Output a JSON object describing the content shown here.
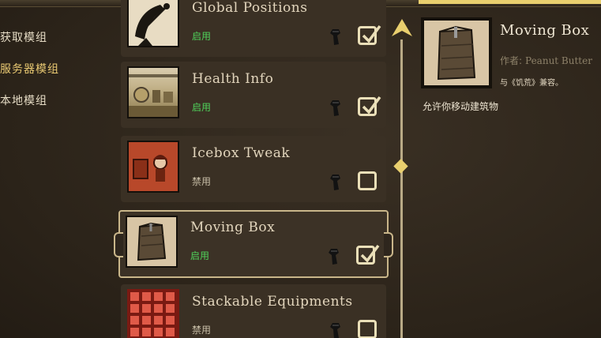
{
  "nav": {
    "items": [
      {
        "label": "获取模组",
        "active": false
      },
      {
        "label": "服务器模组",
        "active": true
      },
      {
        "label": "本地模组",
        "active": false
      }
    ]
  },
  "mods": [
    {
      "name": "Global Positions",
      "status": "启用",
      "enabled": true,
      "icon": "satellite-dish-icon"
    },
    {
      "name": "Health Info",
      "status": "启用",
      "enabled": true,
      "icon": "health-info-thumbnail"
    },
    {
      "name": "Icebox Tweak",
      "status": "禁用",
      "enabled": false,
      "icon": "icebox-tweak-thumbnail"
    },
    {
      "name": "Moving Box",
      "status": "启用",
      "enabled": true,
      "selected": true,
      "icon": "moving-box-thumbnail"
    },
    {
      "name": "Stackable Equipments",
      "status": "禁用",
      "enabled": false,
      "icon": "stackable-equipments-thumbnail"
    }
  ],
  "detail": {
    "title": "Moving Box",
    "author_label": "作者:",
    "author": "Peanut Butter",
    "compat": "与《饥荒》兼容。",
    "description": "允许你移动建筑物"
  },
  "colors": {
    "enabled": "#4fd15a",
    "disabled": "#c9bfa8",
    "accent": "#e9cf6e",
    "background": "#2e261d"
  }
}
